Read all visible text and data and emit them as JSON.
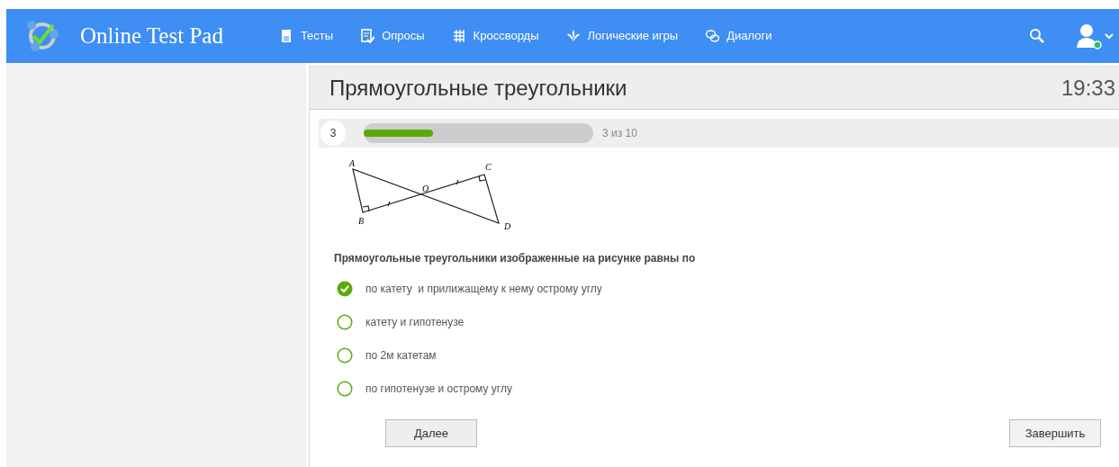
{
  "header": {
    "logo_text": "Online Test Pad",
    "nav": [
      {
        "label": "Тесты",
        "kind": "tests"
      },
      {
        "label": "Опросы",
        "kind": "polls"
      },
      {
        "label": "Кроссворды",
        "kind": "crosswords"
      },
      {
        "label": "Логические игры",
        "kind": "games"
      },
      {
        "label": "Диалоги",
        "kind": "dialogs"
      }
    ],
    "user_online": true
  },
  "test": {
    "title": "Прямоугольные треугольники",
    "timer": "19:33",
    "question_number": "3",
    "progress": {
      "level": 0.3,
      "text": "3 из 10"
    },
    "figure_labels": [
      "A",
      "B",
      "O",
      "C",
      "D"
    ],
    "question": "Прямоугольные треугольники изображенные на рисунке равны по",
    "options": [
      {
        "label": "по катету  и прилижащему к нему острому углу",
        "selected": true
      },
      {
        "label": "катету и гипотенузе",
        "selected": false
      },
      {
        "label": "по 2м катетам",
        "selected": false
      },
      {
        "label": "по гипотенузе и острому углу",
        "selected": false
      }
    ],
    "buttons": {
      "next": "Далее",
      "finish": "Завершить"
    }
  }
}
